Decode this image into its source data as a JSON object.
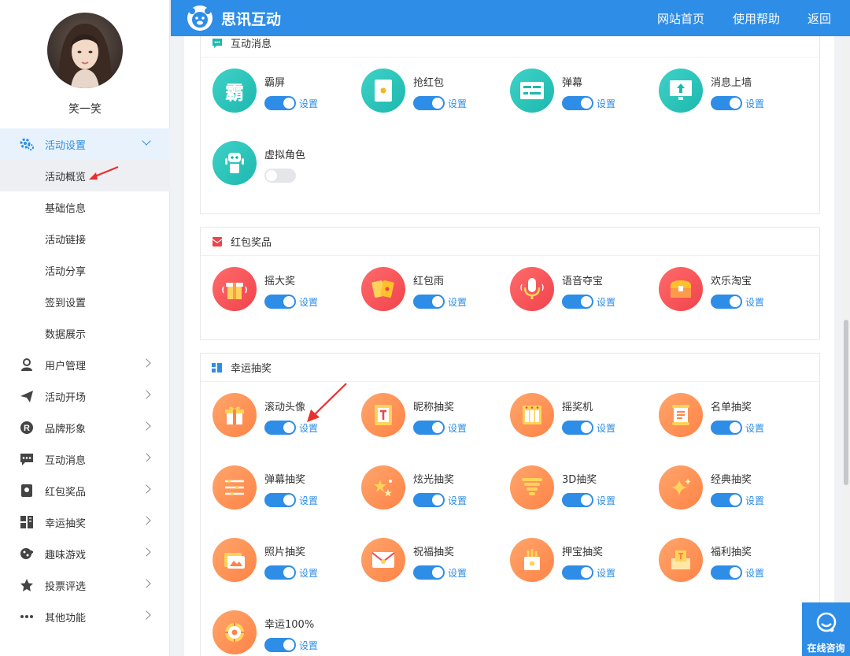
{
  "header": {
    "brand": "思讯互动",
    "links": [
      "网站首页",
      "使用帮助",
      "返回"
    ]
  },
  "user": {
    "name": "笑一笑"
  },
  "menu": {
    "active": {
      "label": "活动设置",
      "icon": "gear-icon"
    },
    "sub_items": [
      "活动概览",
      "基础信息",
      "活动链接",
      "活动分享",
      "签到设置",
      "数据展示"
    ],
    "items": [
      {
        "label": "用户管理",
        "icon": "user-icon"
      },
      {
        "label": "活动开场",
        "icon": "paper-plane-icon"
      },
      {
        "label": "品牌形象",
        "icon": "registered-icon"
      },
      {
        "label": "互动消息",
        "icon": "chat-icon"
      },
      {
        "label": "红包奖品",
        "icon": "red-packet-icon"
      },
      {
        "label": "幸运抽奖",
        "icon": "lottery-icon"
      },
      {
        "label": "趣味游戏",
        "icon": "gamepad-icon"
      },
      {
        "label": "投票评选",
        "icon": "star-icon"
      },
      {
        "label": "其他功能",
        "icon": "more-icon"
      }
    ]
  },
  "sections": {
    "interact": {
      "title": "互动消息",
      "items": [
        {
          "name": "霸屏",
          "enabled": true,
          "icon": "bapin-icon"
        },
        {
          "name": "抢红包",
          "enabled": true,
          "icon": "red-envelope-icon"
        },
        {
          "name": "弹幕",
          "enabled": true,
          "icon": "danmaku-icon"
        },
        {
          "name": "消息上墙",
          "enabled": true,
          "icon": "message-wall-icon"
        },
        {
          "name": "虚拟角色",
          "enabled": false,
          "icon": "robot-icon"
        }
      ]
    },
    "redpack": {
      "title": "红包奖品",
      "items": [
        {
          "name": "摇大奖",
          "enabled": true,
          "icon": "shake-gift-icon"
        },
        {
          "name": "红包雨",
          "enabled": true,
          "icon": "red-rain-icon"
        },
        {
          "name": "语音夺宝",
          "enabled": true,
          "icon": "microphone-icon"
        },
        {
          "name": "欢乐淘宝",
          "enabled": true,
          "icon": "treasure-chest-icon"
        }
      ]
    },
    "lucky": {
      "title": "幸运抽奖",
      "items": [
        {
          "name": "滚动头像",
          "enabled": true,
          "icon": "gift-box-icon"
        },
        {
          "name": "昵称抽奖",
          "enabled": true,
          "icon": "nickname-card-icon"
        },
        {
          "name": "摇奖机",
          "enabled": true,
          "icon": "slot-machine-icon"
        },
        {
          "name": "名单抽奖",
          "enabled": true,
          "icon": "list-scroll-icon"
        },
        {
          "name": "弹幕抽奖",
          "enabled": true,
          "icon": "danmaku-lines-icon"
        },
        {
          "name": "炫光抽奖",
          "enabled": true,
          "icon": "sparkle-stars-icon"
        },
        {
          "name": "3D抽奖",
          "enabled": true,
          "icon": "tornado-icon"
        },
        {
          "name": "经典抽奖",
          "enabled": true,
          "icon": "sparkle-icon"
        },
        {
          "name": "照片抽奖",
          "enabled": true,
          "icon": "photo-icon"
        },
        {
          "name": "祝福抽奖",
          "enabled": true,
          "icon": "envelope-icon"
        },
        {
          "name": "押宝抽奖",
          "enabled": true,
          "icon": "bet-box-icon"
        },
        {
          "name": "福利抽奖",
          "enabled": true,
          "icon": "welfare-box-icon"
        },
        {
          "name": "幸运100%",
          "enabled": true,
          "icon": "lucky-wheel-icon"
        }
      ]
    }
  },
  "setting_label": "设置",
  "consult": {
    "label": "在线咨询"
  },
  "colors": {
    "primary": "#2e8de6",
    "teal": "#1db8ae",
    "red": "#f0434b",
    "orange": "#ff8347"
  }
}
